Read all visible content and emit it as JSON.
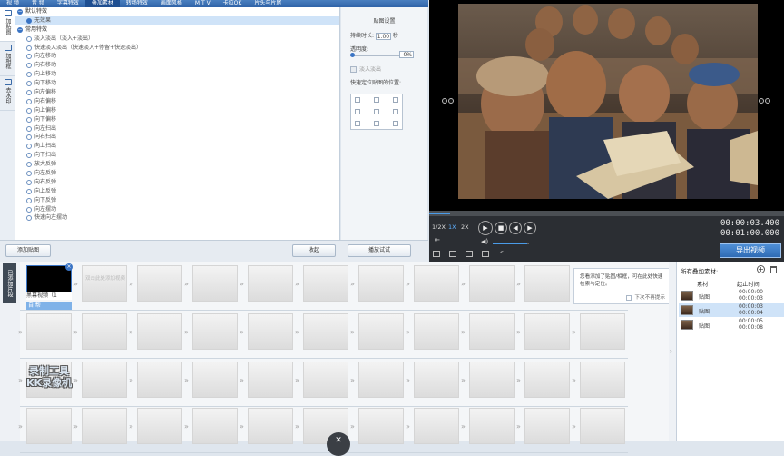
{
  "top_tabs": [
    {
      "label": "视 频"
    },
    {
      "label": "音 频"
    },
    {
      "label": "字幕特效"
    },
    {
      "label": "叠加素材",
      "active": true
    },
    {
      "label": "转场特效"
    },
    {
      "label": "画面风格"
    },
    {
      "label": "M T V"
    },
    {
      "label": "卡拉OK"
    },
    {
      "label": "片头与片尾"
    }
  ],
  "side_tabs": [
    {
      "label": "加贴图",
      "active": true
    },
    {
      "label": "加相框"
    },
    {
      "label": "去水印"
    }
  ],
  "effects": {
    "groups": [
      {
        "label": "默认特效",
        "items": [
          {
            "label": "无效果",
            "selected": true
          }
        ]
      },
      {
        "label": "常用特效",
        "items": [
          {
            "label": "淡入淡出（淡入+淡出）"
          },
          {
            "label": "快速淡入淡出（快速淡入+停留+快速淡出）"
          },
          {
            "label": "向左移动"
          },
          {
            "label": "向右移动"
          },
          {
            "label": "向上移动"
          },
          {
            "label": "向下移动"
          },
          {
            "label": "向左偏移"
          },
          {
            "label": "向右偏移"
          },
          {
            "label": "向上偏移"
          },
          {
            "label": "向下偏移"
          },
          {
            "label": "向左扫出"
          },
          {
            "label": "向右扫出"
          },
          {
            "label": "向上扫出"
          },
          {
            "label": "向下扫出"
          },
          {
            "label": "放大反弹"
          },
          {
            "label": "向左反弹"
          },
          {
            "label": "向右反弹"
          },
          {
            "label": "向上反弹"
          },
          {
            "label": "向下反弹"
          },
          {
            "label": "向左摆动"
          },
          {
            "label": "快速向左摆动"
          }
        ]
      }
    ]
  },
  "settings": {
    "title": "贴图设置",
    "duration_label": "持续时长:",
    "duration_value": "1.00",
    "duration_unit": "秒",
    "opacity_label": "透明度:",
    "opacity_value": "0%",
    "fade_label": "淡入淡出",
    "position_label": "快速定位贴图的位置:"
  },
  "preview": {
    "speeds": [
      "1/2X",
      "1X",
      "2X"
    ],
    "active_speed": "1X",
    "time_current": "00:00:03.400",
    "time_total": "00:01:00.000",
    "export_label": "导出视频",
    "volume_level": 0.95,
    "progress": 0.06
  },
  "buttons": {
    "add_sticker": "添加贴图",
    "collapse": "收起",
    "play_preview": "播放试试"
  },
  "timeline": {
    "side_label": "已添加片段",
    "clip_name": "黑幕视频（1",
    "clip_tag": "自 帮",
    "empty_hint": "双击此处添加视频",
    "watermark_line1": "录制工具",
    "watermark_line2": "KK录像机",
    "close_glyph": "✕"
  },
  "popup": {
    "text": "您看添加了贴图/相框，可在此处快速检索与定位。",
    "dont_show": "下次不再提示"
  },
  "asset_panel": {
    "title": "所有叠加素材:",
    "col_material": "素材",
    "col_time": "起止时间",
    "rows": [
      {
        "name": "贴图",
        "start": "00:00:00",
        "end": "00:00:03"
      },
      {
        "name": "贴图",
        "start": "00:00:03",
        "end": "00:00:04",
        "selected": true
      },
      {
        "name": "贴图",
        "start": "00:00:05",
        "end": "00:00:08"
      }
    ]
  },
  "colors": {
    "accent": "#3a74c4",
    "topbar": "#2f63a8",
    "player_bg": "#2b2e33"
  }
}
